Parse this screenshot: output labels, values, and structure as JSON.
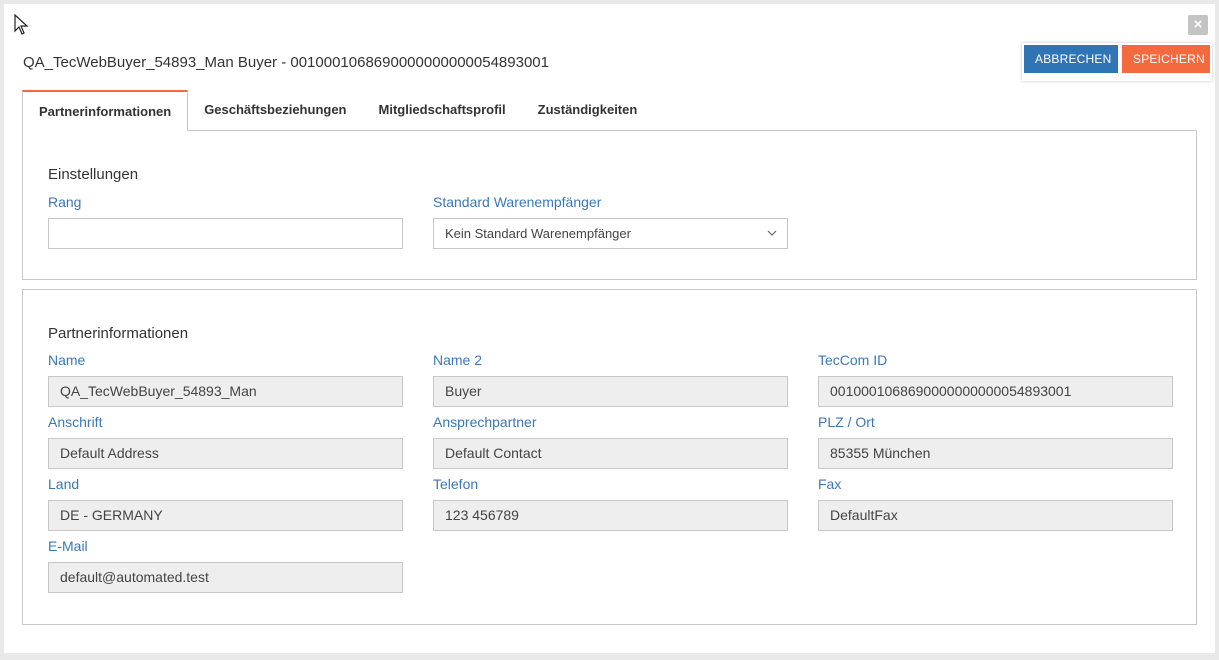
{
  "dialog": {
    "title": "QA_TecWebBuyer_54893_Man Buyer - 0010001068690000000000054893001",
    "close_icon": "close-icon",
    "buttons": {
      "cancel_label": "ABBRECHEN",
      "save_label": "SPEICHERN"
    },
    "colors": {
      "cancel": "#2f75b5",
      "save": "#f26a3d",
      "label": "#3a78b8"
    }
  },
  "tabs": [
    {
      "label": "Partnerinformationen",
      "active": true
    },
    {
      "label": "Geschäftsbeziehungen",
      "active": false
    },
    {
      "label": "Mitgliedschaftsprofil",
      "active": false
    },
    {
      "label": "Zuständigkeiten",
      "active": false
    }
  ],
  "settings": {
    "title": "Einstellungen",
    "rang": {
      "label": "Rang",
      "value": ""
    },
    "standard_recipient": {
      "label": "Standard Warenempfänger",
      "selected": "Kein Standard Warenempfänger"
    }
  },
  "partner": {
    "title": "Partnerinformationen",
    "fields": {
      "name": {
        "label": "Name",
        "value": "QA_TecWebBuyer_54893_Man"
      },
      "name2": {
        "label": "Name 2",
        "value": "Buyer"
      },
      "teccom_id": {
        "label": "TecCom ID",
        "value": "0010001068690000000000054893001"
      },
      "address": {
        "label": "Anschrift",
        "value": "Default Address"
      },
      "contact": {
        "label": "Ansprechpartner",
        "value": "Default Contact"
      },
      "zip_city": {
        "label": "PLZ / Ort",
        "value": "85355 München"
      },
      "country": {
        "label": "Land",
        "value": "DE - GERMANY"
      },
      "phone": {
        "label": "Telefon",
        "value": "123 456789"
      },
      "fax": {
        "label": "Fax",
        "value": "DefaultFax"
      },
      "email": {
        "label": "E-Mail",
        "value": "default@automated.test"
      }
    }
  }
}
